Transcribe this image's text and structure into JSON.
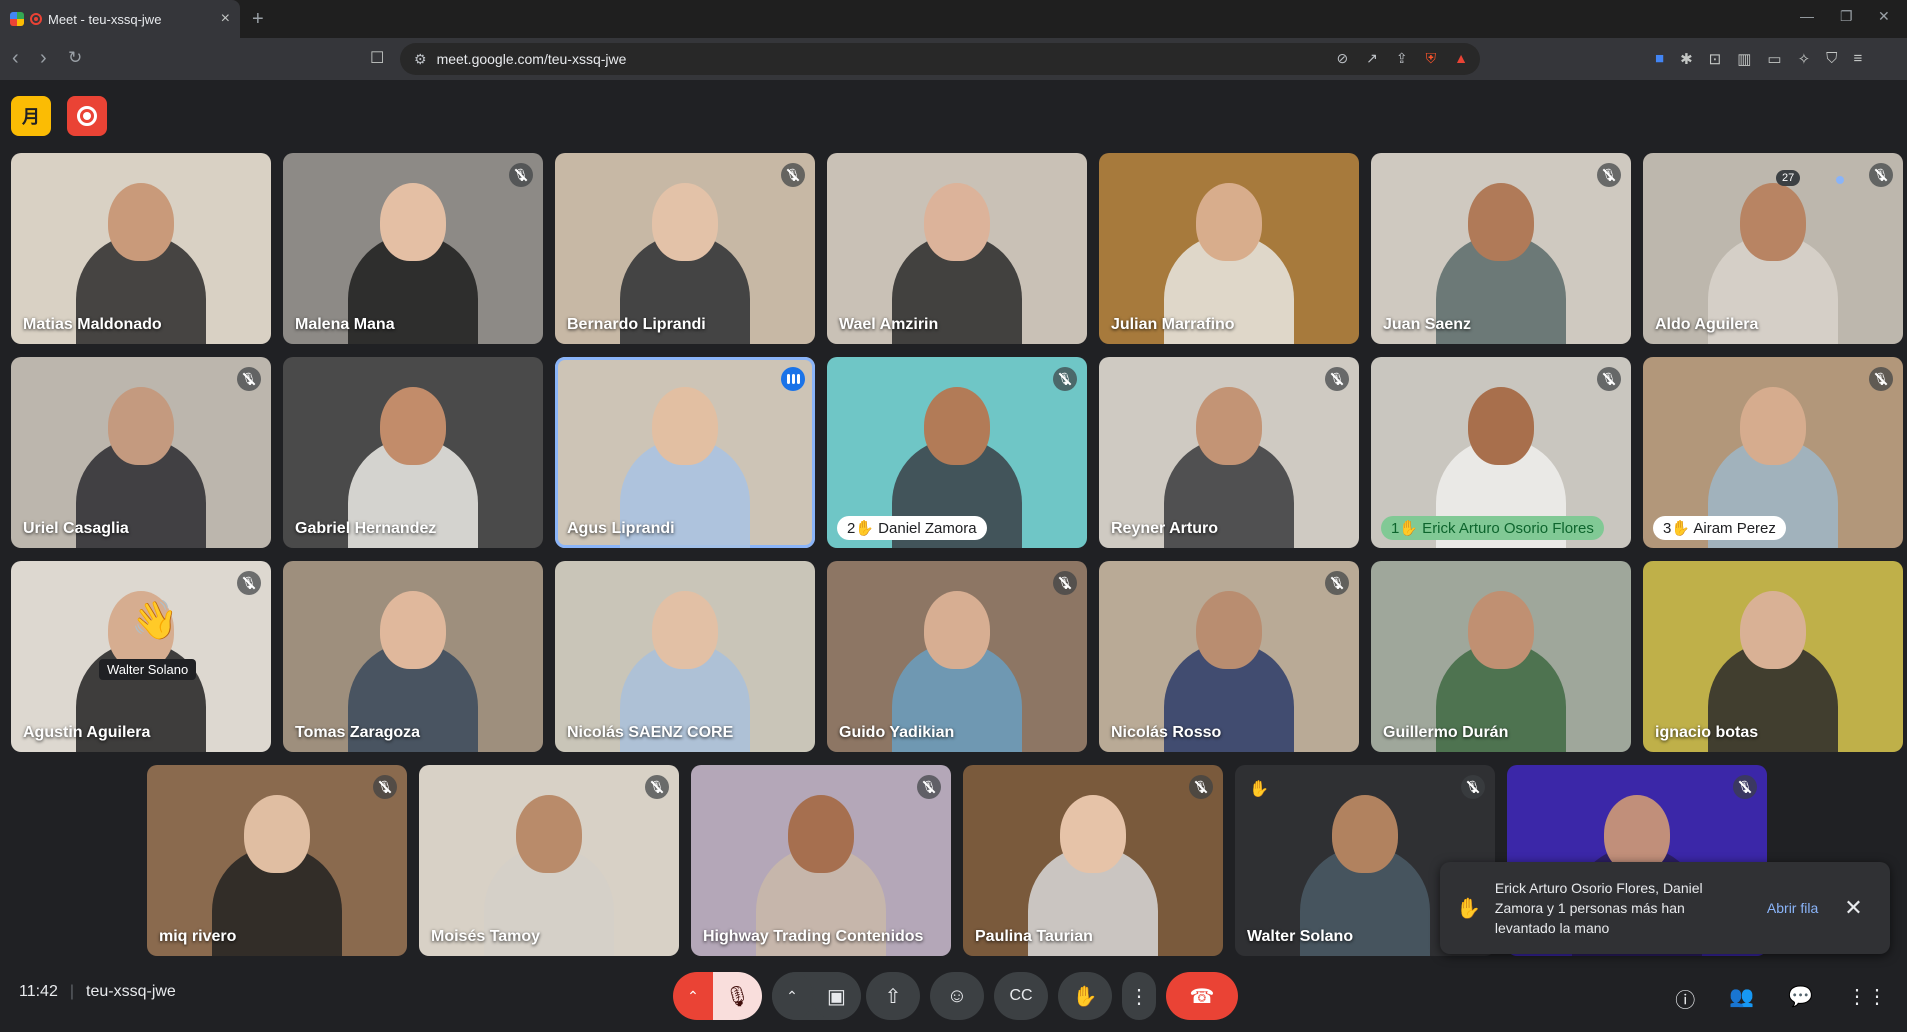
{
  "browser": {
    "tab_title": "Meet - teu-xssq-jwe",
    "tab_close": "×",
    "new_tab": "+",
    "url": "meet.google.com/teu-xssq-jwe",
    "win_min": "—",
    "win_max": "❐",
    "win_close": "✕"
  },
  "meet": {
    "ai_badge": "月",
    "tiles": [
      {
        "name": "Matias Maldonado",
        "muted": false,
        "bg": "#d9d1c4",
        "skin": "#c99a7a",
        "shirt": "#2b2b2b"
      },
      {
        "name": "Malena Mana",
        "muted": true,
        "bg": "#8d8a86",
        "skin": "#e4bfa4",
        "shirt": "#1d1d1d"
      },
      {
        "name": "Bernardo Liprandi",
        "muted": true,
        "bg": "#c7b8a5",
        "skin": "#e3c2a8",
        "shirt": "#2d2f33"
      },
      {
        "name": "Wael Amzirin",
        "muted": false,
        "bg": "#c9c1b6",
        "skin": "#dcb39a",
        "shirt": "#2a2a2a"
      },
      {
        "name": "Julian Marrafino",
        "muted": false,
        "bg": "#a77a3c",
        "skin": "#d8ad8c",
        "shirt": "#e9e7e2"
      },
      {
        "name": "Juan Saenz",
        "muted": true,
        "bg": "#cfc9c0",
        "skin": "#b07a58",
        "shirt": "#5b6b6a"
      },
      {
        "name": "Aldo Aguilera",
        "muted": true,
        "bg": "#bdb7ad",
        "skin": "#b88463",
        "shirt": "#d9d4cb"
      },
      {
        "name": "Uriel Casaglia",
        "muted": true,
        "bg": "#bcb6ad",
        "skin": "#c49a7f",
        "shirt": "#2b2c30"
      },
      {
        "name": "Gabriel Hernandez",
        "muted": false,
        "bg": "#4a4a4a",
        "skin": "#c28c6a",
        "shirt": "#ecebe6"
      },
      {
        "name": "Agus Liprandi",
        "muted": false,
        "bg": "#cdc4b6",
        "skin": "#e2bfa2",
        "shirt": "#a8c3e4"
      },
      {
        "name": "Daniel Zamora",
        "muted": true,
        "bg": "#6fc6c6",
        "skin": "#b27b57",
        "shirt": "#3b3f46",
        "pill": "2✋ Daniel Zamora"
      },
      {
        "name": "Reyner Arturo",
        "muted": true,
        "bg": "#cfcac2",
        "skin": "#c39475",
        "shirt": "#3a3b3d"
      },
      {
        "name": "Erick Arturo Osorio Flores",
        "muted": true,
        "bg": "#c9c6bf",
        "skin": "#a86f4c",
        "shirt": "#f0efec",
        "pill": "1✋ Erick Arturo Osorio Flores"
      },
      {
        "name": "Airam Perez",
        "muted": true,
        "bg": "#b2977a",
        "skin": "#d6ac8e",
        "shirt": "#9db6c8",
        "pill": "3✋ Airam Perez"
      },
      {
        "name": "Agustin Aguilera",
        "muted": true,
        "bg": "#ddd8d0",
        "skin": "#d6ad90",
        "shirt": "#222"
      },
      {
        "name": "Tomas Zaragoza",
        "muted": false,
        "bg": "#9e8f7d",
        "skin": "#e0b89c",
        "shirt": "#3a4a5c"
      },
      {
        "name": "Nicolás SAENZ CORE",
        "muted": false,
        "bg": "#c9c5b8",
        "skin": "#e2c0a5",
        "shirt": "#a9bfdb"
      },
      {
        "name": "Guido Yadikian",
        "muted": true,
        "bg": "#8d7664",
        "skin": "#d7ae92",
        "shirt": "#6a9fbf"
      },
      {
        "name": "Nicolás Rosso",
        "muted": true,
        "bg": "#b9aa96",
        "skin": "#b98d70",
        "shirt": "#2c3c6a"
      },
      {
        "name": "Guillermo Durán",
        "muted": false,
        "bg": "#9fa79b",
        "skin": "#c09072",
        "shirt": "#3f6a43"
      },
      {
        "name": "ignacio botas",
        "muted": false,
        "bg": "#bfb049",
        "skin": "#d9b195",
        "shirt": "#2a2a2a"
      },
      {
        "name": "miq rivero",
        "muted": true,
        "bg": "#8a6a4e",
        "skin": "#e0bea2",
        "shirt": "#222"
      },
      {
        "name": "Moisés Tamoy",
        "muted": true,
        "bg": "#d8d1c6",
        "skin": "#b98b6a",
        "shirt": "#d5d0c8"
      },
      {
        "name": "Highway Trading Contenidos",
        "muted": true,
        "bg": "#b4a7b8",
        "skin": "#a66f4f",
        "shirt": "#c9b8a8"
      },
      {
        "name": "Paulina Taurian",
        "muted": true,
        "bg": "#7a5a3c",
        "skin": "#e6c3a8",
        "shirt": "#d8d8d8"
      },
      {
        "name": "Walter Solano",
        "muted": true,
        "bg": "#2f3033",
        "skin": "#b1825f",
        "shirt": "#4a5a66"
      },
      {
        "name": "",
        "muted": true,
        "bg": "#3b27a8",
        "skin": "#c18f7a",
        "shirt": "#2a1f5a"
      }
    ],
    "hover_label": "Walter Solano",
    "toast": {
      "text": "Erick Arturo Osorio Flores, Daniel Zamora y 1 personas más han levantado la mano",
      "link": "Abrir fila"
    },
    "bottom": {
      "time": "11:42",
      "meeting_code": "teu-xssq-jwe",
      "participant_count": "27"
    }
  }
}
